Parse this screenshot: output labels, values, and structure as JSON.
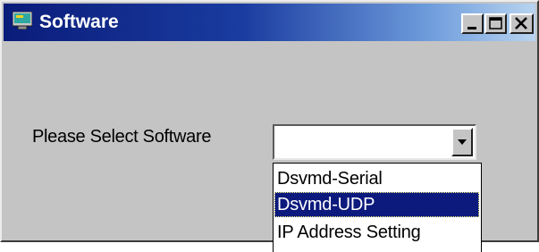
{
  "window": {
    "title": "Software",
    "icon": "computer-monitor-icon",
    "title_gradient": [
      "#0a1c7a",
      "#1a3ca0",
      "#6e9cdc",
      "#b8d4f0"
    ],
    "controls": [
      "minimize-icon",
      "maximize-icon",
      "close-icon"
    ]
  },
  "form": {
    "prompt_label": "Please Select Software",
    "combo": {
      "value": "",
      "arrow_icon": "chevron-down-icon"
    }
  },
  "dropdown": {
    "options": [
      {
        "label": "Dsvmd-Serial",
        "selected": false
      },
      {
        "label": "Dsvmd-UDP",
        "selected": true
      },
      {
        "label": "IP Address Setting",
        "selected": false
      }
    ],
    "highlight_color": "#0c1a7e"
  }
}
